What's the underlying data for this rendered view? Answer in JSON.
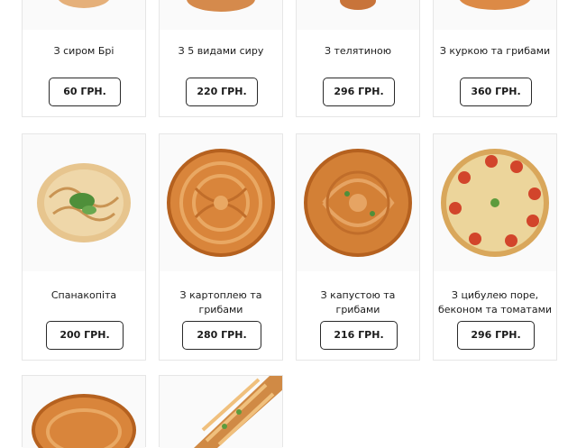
{
  "products": [
    {
      "name": "З сиром Брі",
      "price": "60 ГРН.",
      "icon": "pie-image"
    },
    {
      "name": "З 5 видами сиру",
      "price": "220 ГРН.",
      "icon": "pie-image"
    },
    {
      "name": "З телятиною",
      "price": "296 ГРН.",
      "icon": "pie-image"
    },
    {
      "name": "З куркою та грибами",
      "price": "360 ГРН.",
      "icon": "pie-image"
    },
    {
      "name": "Спанакопіта",
      "price": "200 ГРН.",
      "icon": "spanakopita-image"
    },
    {
      "name": "З картоплею та грибами",
      "price": "280 ГРН.",
      "icon": "pie-image"
    },
    {
      "name": "З капустою та грибами",
      "price": "216 ГРН.",
      "icon": "pie-image"
    },
    {
      "name": "З цибулею поре, беконом та томатами",
      "price": "296 ГРН.",
      "icon": "quiche-image"
    },
    {
      "name": "",
      "price": "",
      "icon": "pie-image"
    },
    {
      "name": "",
      "price": "",
      "icon": "strudel-image"
    }
  ],
  "colors": {
    "border": "#e6e6e6",
    "button_border": "#2a2a2a",
    "pie_crust": "#d9853b",
    "pie_dark": "#b5611f",
    "quiche": "#e8cc8a",
    "tomato": "#d2452b"
  }
}
